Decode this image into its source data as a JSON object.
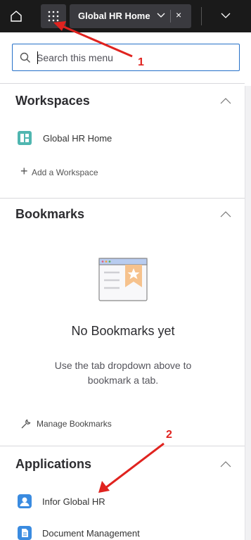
{
  "topbar": {
    "tab_label": "Global HR Home",
    "tab_close": "×"
  },
  "search": {
    "placeholder": "Search this menu"
  },
  "workspaces": {
    "title": "Workspaces",
    "items": [
      {
        "label": "Global HR Home",
        "icon": "workspace-icon"
      }
    ],
    "add_label": "Add a Workspace"
  },
  "bookmarks": {
    "title": "Bookmarks",
    "empty_title": "No Bookmarks yet",
    "empty_text": "Use the tab dropdown above to bookmark a tab.",
    "manage_label": "Manage Bookmarks"
  },
  "applications": {
    "title": "Applications",
    "items": [
      {
        "label": "Infor Global HR",
        "icon": "person-icon"
      },
      {
        "label": "Document Management",
        "icon": "document-icon"
      }
    ]
  },
  "annotations": {
    "marker_1": "1",
    "marker_2": "2",
    "color": "#e0231f"
  },
  "colors": {
    "topbar": "#1a1a1a",
    "accent": "#2570c8",
    "workspace_icon": "#4fb6b0",
    "app_icon": "#3a8be0"
  }
}
